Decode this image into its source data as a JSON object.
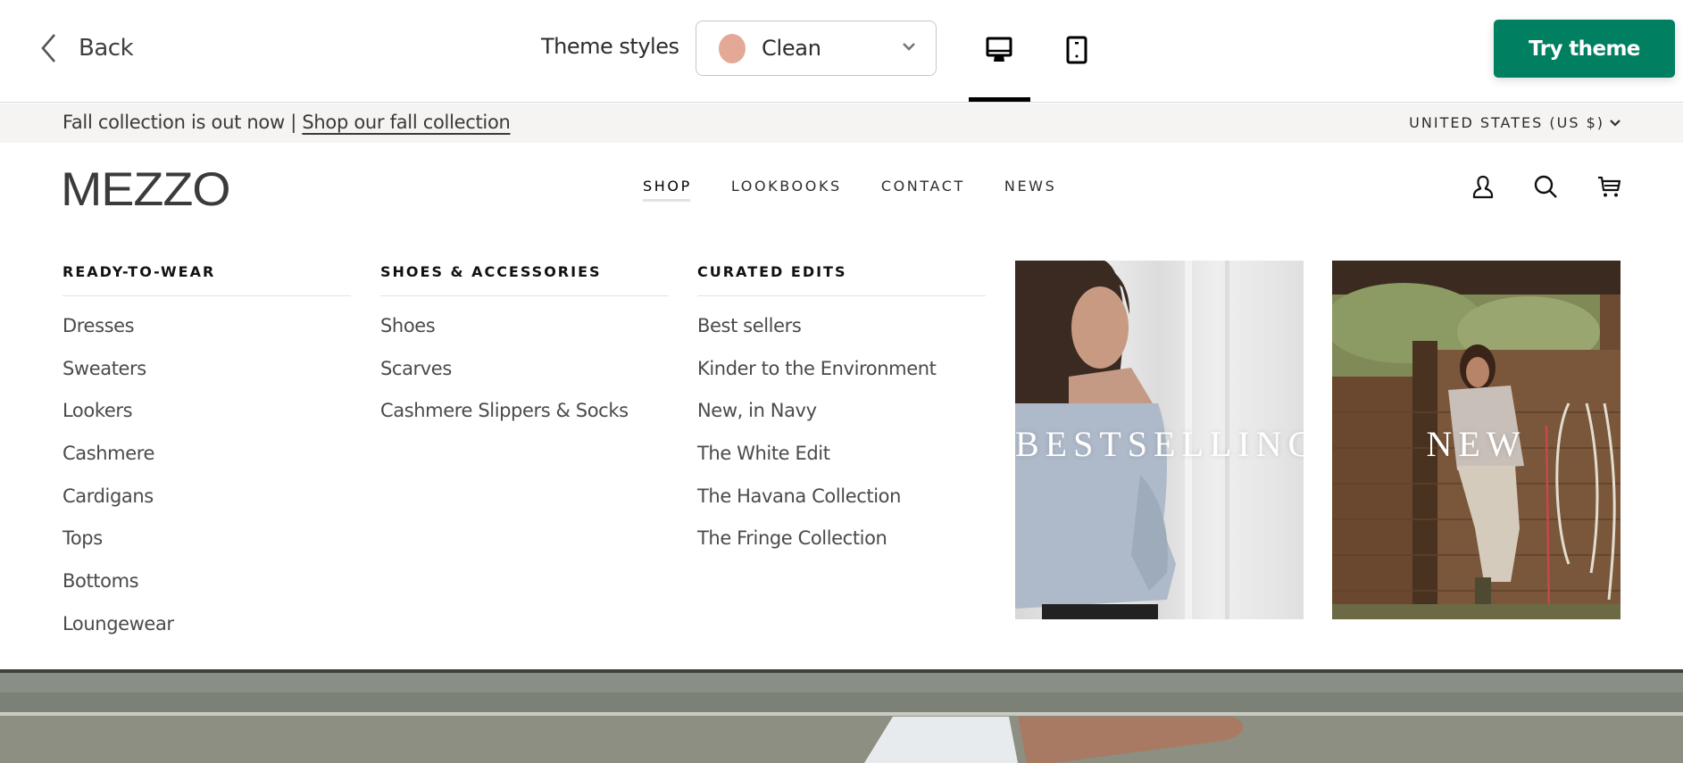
{
  "editor_bar": {
    "back_label": "Back",
    "theme_styles_label": "Theme styles",
    "theme_select": {
      "value": "Clean",
      "swatch_color": "#e3a996"
    },
    "devices": [
      {
        "name": "desktop",
        "icon": "desktop-icon",
        "active": true
      },
      {
        "name": "mobile",
        "icon": "mobile-icon",
        "active": false
      }
    ],
    "try_theme_label": "Try theme",
    "accent_color": "#008060"
  },
  "announcement": {
    "text": "Fall collection is out now | ",
    "link_label": "Shop our fall collection",
    "country_selector": "UNITED STATES (US $)"
  },
  "header": {
    "logo": "MEZZO",
    "nav": [
      {
        "label": "SHOP",
        "active": true
      },
      {
        "label": "LOOKBOOKS",
        "active": false
      },
      {
        "label": "CONTACT",
        "active": false
      },
      {
        "label": "NEWS",
        "active": false
      }
    ],
    "icons": [
      "account-icon",
      "search-icon",
      "cart-icon"
    ]
  },
  "mega_menu": {
    "columns": [
      {
        "heading": "READY-TO-WEAR",
        "items": [
          "Dresses",
          "Sweaters",
          "Lookers",
          "Cashmere",
          "Cardigans",
          "Tops",
          "Bottoms",
          "Loungewear"
        ]
      },
      {
        "heading": "SHOES & ACCESSORIES",
        "items": [
          "Shoes",
          "Scarves",
          "Cashmere Slippers & Socks"
        ]
      },
      {
        "heading": "CURATED EDITS",
        "items": [
          "Best sellers",
          "Kinder to the Environment",
          "New, in Navy",
          "The White Edit",
          "The Havana Collection",
          "The Fringe Collection"
        ]
      }
    ],
    "promos": [
      {
        "caption": "BESTSELLING"
      },
      {
        "caption": "NEW"
      }
    ]
  }
}
